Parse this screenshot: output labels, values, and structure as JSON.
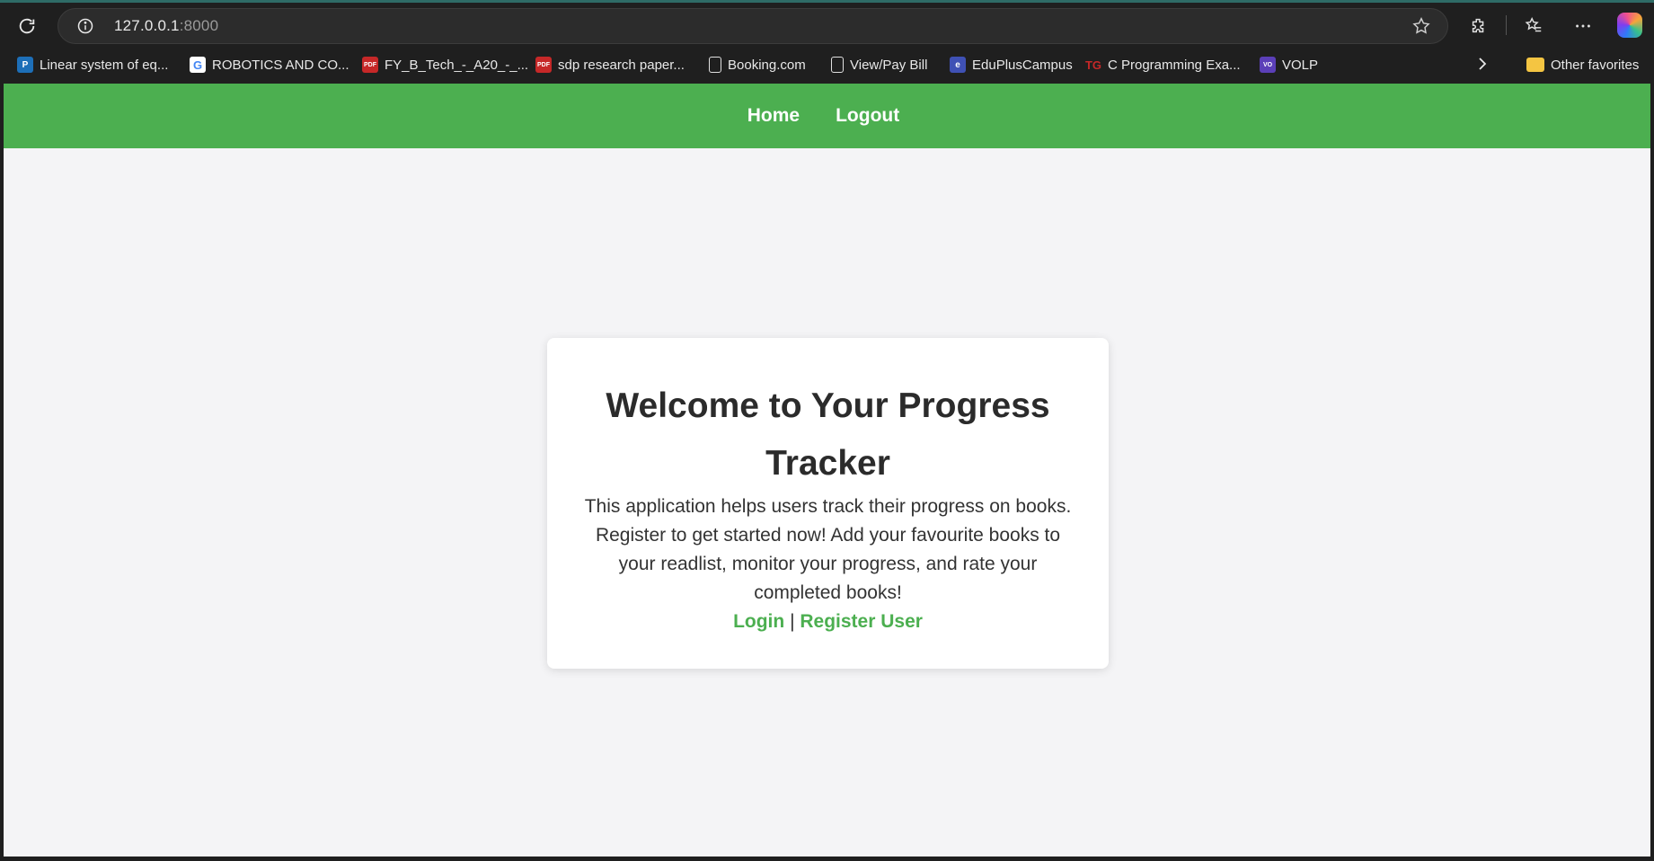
{
  "browser": {
    "url_host": "127.0.0.1",
    "url_port": ":8000",
    "bookmarks": [
      {
        "label": "Linear system of eq...",
        "icon": "p-logo-icon"
      },
      {
        "label": "ROBOTICS AND CO...",
        "icon": "google-icon"
      },
      {
        "label": "FY_B_Tech_-_A20_-_...",
        "icon": "pdf-icon"
      },
      {
        "label": "sdp research paper...",
        "icon": "pdf-icon"
      },
      {
        "label": "Booking.com",
        "icon": "document-icon"
      },
      {
        "label": "View/Pay Bill",
        "icon": "document-icon"
      },
      {
        "label": "EduPlusCampus",
        "icon": "eduplus-icon"
      },
      {
        "label": "C Programming Exa...",
        "icon": "tg-icon"
      },
      {
        "label": "VOLP",
        "icon": "volp-icon"
      }
    ],
    "other_favorites": "Other favorites"
  },
  "page": {
    "nav": {
      "home": "Home",
      "logout": "Logout"
    },
    "card": {
      "title": "Welcome to Your Progress Tracker",
      "description": "This application helps users track their progress on books. Register to get started now! Add your favourite books to your readlist, monitor your progress, and rate your completed books!",
      "login": "Login",
      "separator": "|",
      "register": "Register User"
    }
  },
  "colors": {
    "accent": "#4caf50",
    "page_bg": "#f4f4f6",
    "browser_bg": "#1f1f1f"
  }
}
